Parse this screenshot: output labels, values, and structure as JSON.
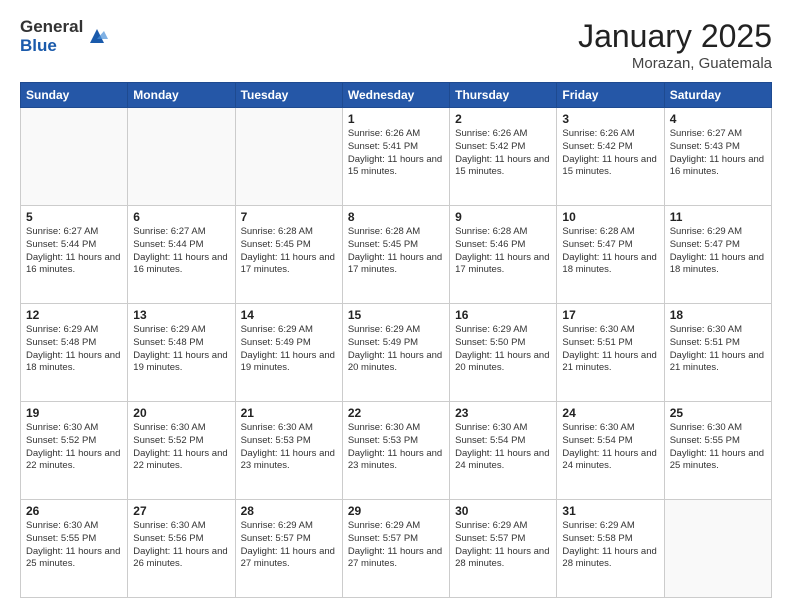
{
  "logo": {
    "general": "General",
    "blue": "Blue"
  },
  "title": "January 2025",
  "location": "Morazan, Guatemala",
  "days_of_week": [
    "Sunday",
    "Monday",
    "Tuesday",
    "Wednesday",
    "Thursday",
    "Friday",
    "Saturday"
  ],
  "weeks": [
    [
      {
        "day": "",
        "text": ""
      },
      {
        "day": "",
        "text": ""
      },
      {
        "day": "",
        "text": ""
      },
      {
        "day": "1",
        "text": "Sunrise: 6:26 AM\nSunset: 5:41 PM\nDaylight: 11 hours and 15 minutes."
      },
      {
        "day": "2",
        "text": "Sunrise: 6:26 AM\nSunset: 5:42 PM\nDaylight: 11 hours and 15 minutes."
      },
      {
        "day": "3",
        "text": "Sunrise: 6:26 AM\nSunset: 5:42 PM\nDaylight: 11 hours and 15 minutes."
      },
      {
        "day": "4",
        "text": "Sunrise: 6:27 AM\nSunset: 5:43 PM\nDaylight: 11 hours and 16 minutes."
      }
    ],
    [
      {
        "day": "5",
        "text": "Sunrise: 6:27 AM\nSunset: 5:44 PM\nDaylight: 11 hours and 16 minutes."
      },
      {
        "day": "6",
        "text": "Sunrise: 6:27 AM\nSunset: 5:44 PM\nDaylight: 11 hours and 16 minutes."
      },
      {
        "day": "7",
        "text": "Sunrise: 6:28 AM\nSunset: 5:45 PM\nDaylight: 11 hours and 17 minutes."
      },
      {
        "day": "8",
        "text": "Sunrise: 6:28 AM\nSunset: 5:45 PM\nDaylight: 11 hours and 17 minutes."
      },
      {
        "day": "9",
        "text": "Sunrise: 6:28 AM\nSunset: 5:46 PM\nDaylight: 11 hours and 17 minutes."
      },
      {
        "day": "10",
        "text": "Sunrise: 6:28 AM\nSunset: 5:47 PM\nDaylight: 11 hours and 18 minutes."
      },
      {
        "day": "11",
        "text": "Sunrise: 6:29 AM\nSunset: 5:47 PM\nDaylight: 11 hours and 18 minutes."
      }
    ],
    [
      {
        "day": "12",
        "text": "Sunrise: 6:29 AM\nSunset: 5:48 PM\nDaylight: 11 hours and 18 minutes."
      },
      {
        "day": "13",
        "text": "Sunrise: 6:29 AM\nSunset: 5:48 PM\nDaylight: 11 hours and 19 minutes."
      },
      {
        "day": "14",
        "text": "Sunrise: 6:29 AM\nSunset: 5:49 PM\nDaylight: 11 hours and 19 minutes."
      },
      {
        "day": "15",
        "text": "Sunrise: 6:29 AM\nSunset: 5:49 PM\nDaylight: 11 hours and 20 minutes."
      },
      {
        "day": "16",
        "text": "Sunrise: 6:29 AM\nSunset: 5:50 PM\nDaylight: 11 hours and 20 minutes."
      },
      {
        "day": "17",
        "text": "Sunrise: 6:30 AM\nSunset: 5:51 PM\nDaylight: 11 hours and 21 minutes."
      },
      {
        "day": "18",
        "text": "Sunrise: 6:30 AM\nSunset: 5:51 PM\nDaylight: 11 hours and 21 minutes."
      }
    ],
    [
      {
        "day": "19",
        "text": "Sunrise: 6:30 AM\nSunset: 5:52 PM\nDaylight: 11 hours and 22 minutes."
      },
      {
        "day": "20",
        "text": "Sunrise: 6:30 AM\nSunset: 5:52 PM\nDaylight: 11 hours and 22 minutes."
      },
      {
        "day": "21",
        "text": "Sunrise: 6:30 AM\nSunset: 5:53 PM\nDaylight: 11 hours and 23 minutes."
      },
      {
        "day": "22",
        "text": "Sunrise: 6:30 AM\nSunset: 5:53 PM\nDaylight: 11 hours and 23 minutes."
      },
      {
        "day": "23",
        "text": "Sunrise: 6:30 AM\nSunset: 5:54 PM\nDaylight: 11 hours and 24 minutes."
      },
      {
        "day": "24",
        "text": "Sunrise: 6:30 AM\nSunset: 5:54 PM\nDaylight: 11 hours and 24 minutes."
      },
      {
        "day": "25",
        "text": "Sunrise: 6:30 AM\nSunset: 5:55 PM\nDaylight: 11 hours and 25 minutes."
      }
    ],
    [
      {
        "day": "26",
        "text": "Sunrise: 6:30 AM\nSunset: 5:55 PM\nDaylight: 11 hours and 25 minutes."
      },
      {
        "day": "27",
        "text": "Sunrise: 6:30 AM\nSunset: 5:56 PM\nDaylight: 11 hours and 26 minutes."
      },
      {
        "day": "28",
        "text": "Sunrise: 6:29 AM\nSunset: 5:57 PM\nDaylight: 11 hours and 27 minutes."
      },
      {
        "day": "29",
        "text": "Sunrise: 6:29 AM\nSunset: 5:57 PM\nDaylight: 11 hours and 27 minutes."
      },
      {
        "day": "30",
        "text": "Sunrise: 6:29 AM\nSunset: 5:57 PM\nDaylight: 11 hours and 28 minutes."
      },
      {
        "day": "31",
        "text": "Sunrise: 6:29 AM\nSunset: 5:58 PM\nDaylight: 11 hours and 28 minutes."
      },
      {
        "day": "",
        "text": ""
      }
    ]
  ]
}
